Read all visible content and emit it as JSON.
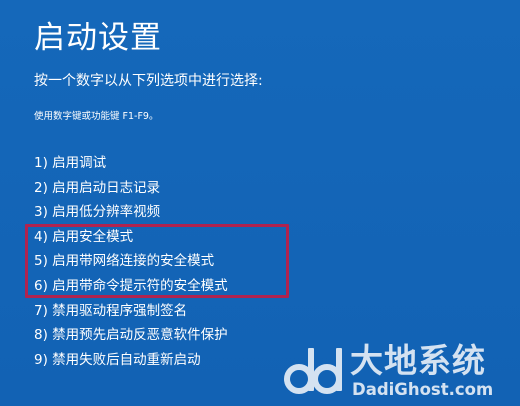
{
  "screen": {
    "title": "启动设置",
    "instruction": "按一个数字以从下列选项中进行选择:",
    "hint": "使用数字键或功能键 F1-F9。"
  },
  "options": [
    {
      "label": "1) 启用调试",
      "highlighted": false
    },
    {
      "label": "2) 启用启动日志记录",
      "highlighted": false
    },
    {
      "label": "3) 启用低分辨率视频",
      "highlighted": false
    },
    {
      "label": "4) 启用安全模式",
      "highlighted": true
    },
    {
      "label": "5) 启用带网络连接的安全模式",
      "highlighted": true
    },
    {
      "label": "6) 启用带命令提示符的安全模式",
      "highlighted": true
    },
    {
      "label": "7) 禁用驱动程序强制签名",
      "highlighted": false
    },
    {
      "label": "8) 禁用预先启动反恶意软件保护",
      "highlighted": false
    },
    {
      "label": "9) 禁用失败后自动重新启动",
      "highlighted": false
    }
  ],
  "watermark": {
    "brand_cn": "大地系统",
    "brand_en": "DadiGhost.com",
    "logo_icon": "dd-logo-icon"
  },
  "colors": {
    "background": "#1466b8",
    "text": "#ffffff",
    "highlight_border": "#b0234f"
  }
}
